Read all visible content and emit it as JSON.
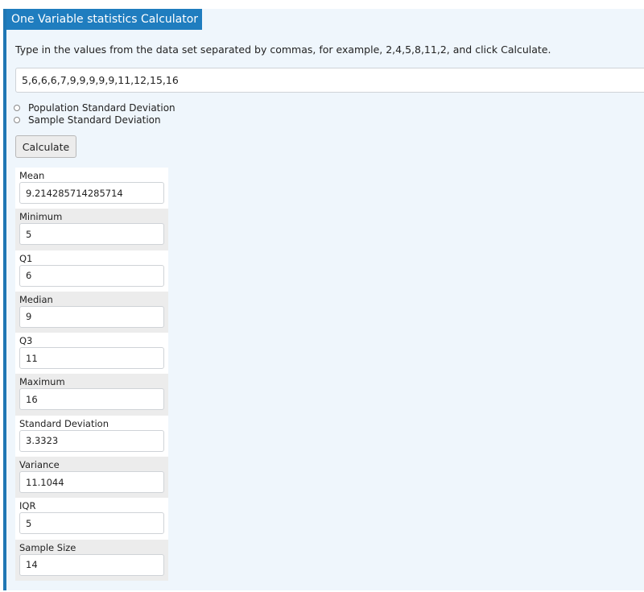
{
  "app": {
    "title": "One Variable statistics Calculator"
  },
  "instructions": "Type in the values from the data set separated by commas, for example, 2,4,5,8,11,2, and click Calculate.",
  "data_input": {
    "value": "5,6,6,6,7,9,9,9,9,9,11,12,15,16",
    "placeholder": ""
  },
  "options": [
    {
      "label": "Population Standard Deviation",
      "selected": false
    },
    {
      "label": "Sample Standard Deviation",
      "selected": false
    }
  ],
  "calculate_button": {
    "label": "Calculate"
  },
  "results": [
    {
      "label": "Mean",
      "value": "9.214285714285714"
    },
    {
      "label": "Minimum",
      "value": "5"
    },
    {
      "label": "Q1",
      "value": "6"
    },
    {
      "label": "Median",
      "value": "9"
    },
    {
      "label": "Q3",
      "value": "11"
    },
    {
      "label": "Maximum",
      "value": "16"
    },
    {
      "label": "Standard Deviation",
      "value": "3.3323"
    },
    {
      "label": "Variance",
      "value": "11.1044"
    },
    {
      "label": "IQR",
      "value": "5"
    },
    {
      "label": "Sample Size",
      "value": "14"
    }
  ],
  "colors": {
    "accent": "#1f7dbf",
    "panel_background": "#eff6fc",
    "row_alt": "#ececec"
  }
}
